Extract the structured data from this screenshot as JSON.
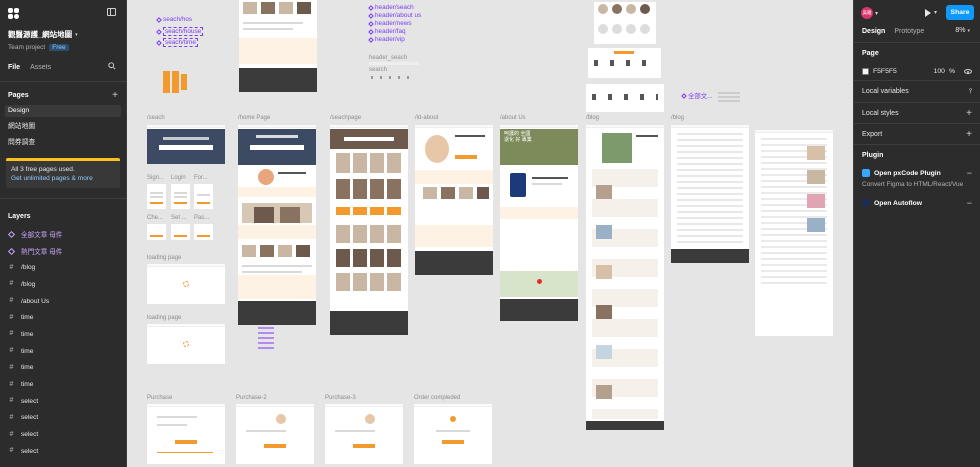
{
  "file": {
    "title": "觀醫源護_網站地圖",
    "project": "Team project",
    "badge": "Free"
  },
  "left_tabs": [
    "File",
    "Assets"
  ],
  "pages_header": "Pages",
  "pages": [
    {
      "label": "Design",
      "selected": true
    },
    {
      "label": "網站地圖",
      "selected": false
    },
    {
      "label": "問券調查",
      "selected": false
    }
  ],
  "notice": {
    "line1": "All 3 free pages used.",
    "line2": "Get unlimited pages & more"
  },
  "layers_header": "Layers",
  "layers": [
    {
      "label": "全部文章 母件",
      "type": "component"
    },
    {
      "label": "熱門文章 母件",
      "type": "component"
    },
    {
      "label": "/blog",
      "type": "frame"
    },
    {
      "label": "/blog",
      "type": "frame"
    },
    {
      "label": "/about Us",
      "type": "frame"
    },
    {
      "label": "time",
      "type": "frame"
    },
    {
      "label": "time",
      "type": "frame"
    },
    {
      "label": "time",
      "type": "frame"
    },
    {
      "label": "time",
      "type": "frame"
    },
    {
      "label": "time",
      "type": "frame"
    },
    {
      "label": "select",
      "type": "frame"
    },
    {
      "label": "select",
      "type": "frame"
    },
    {
      "label": "select",
      "type": "frame"
    },
    {
      "label": "select",
      "type": "frame"
    }
  ],
  "canvas": {
    "components_top": [
      "seach/hos",
      "seach/house",
      "seach/time"
    ],
    "header_components": [
      "header/seach",
      "header/about us",
      "header/news",
      "header/faq",
      "header/vip"
    ],
    "header_seach_label": "header_seach",
    "search_label": "search",
    "all_articles_label": "全部文...",
    "frame_labels": {
      "seach": "/seach",
      "home": "/home Page",
      "seachpage": "/seachpage",
      "id_about": "/id-about",
      "about_us": "/about Us",
      "blog1": "/blog",
      "blog2": "/blog",
      "signin": "Sign...",
      "login": "Login",
      "forgot": "For...",
      "check": "Che...",
      "set": "Set ...",
      "pass": "Pas...",
      "loading1": "loading page",
      "loading2": "loading page",
      "purchase": "Purchase",
      "purchase2": "Purchase-2",
      "purchase3": "Purchase-3",
      "order": "Order compleded"
    },
    "hero_text_about": "呵護的 全國 退化 好 專業"
  },
  "right": {
    "avatar": "吳雅",
    "share": "Share",
    "tabs": [
      "Design",
      "Prototype"
    ],
    "zoom": "8%",
    "page_header": "Page",
    "page_color": "F5F5F5",
    "page_opacity": "100",
    "pct_sign": "%",
    "local_variables": "Local variables",
    "local_styles": "Local styles",
    "export": "Export",
    "plugin_header": "Plugin",
    "plugins": [
      {
        "name": "Open pxCode Plugin",
        "desc": "Convert Figma to HTML/React/Vue",
        "color": "#3aa8ff"
      },
      {
        "name": "Open Autoflow",
        "desc": "",
        "color": "#1f2b57"
      }
    ]
  },
  "colors": {
    "accent": "#0d99ff",
    "component": "#7b3ff2",
    "brand_orange": "#f29a2e",
    "notice": "#ffc21a"
  }
}
